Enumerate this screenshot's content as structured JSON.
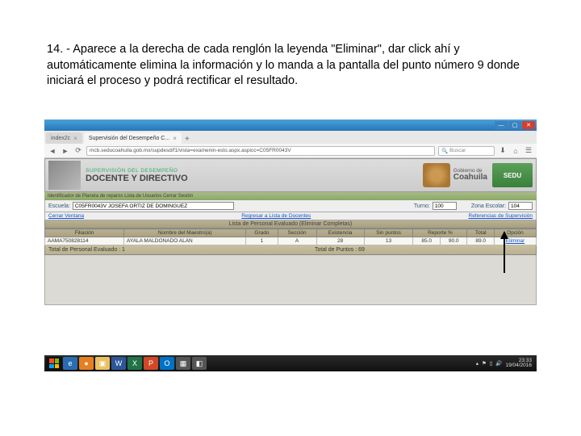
{
  "instruction": "14. - Aparece a la derecha de cada renglón la leyenda \"Eliminar\", dar click ahí  y automáticamente elimina la información y lo manda a la pantalla del punto número 9 donde iniciará el proceso y podrá rectificar el resultado.",
  "browser": {
    "tab1": "index2c",
    "tab2": "Supervisión del Desempeño C...",
    "url": "mcb.seducoahuila.gob.mx/supdesd/f1/vista=examenin-esto.aspx.aspicc=C05FR0043V",
    "search_placeholder": "Buscar"
  },
  "banner": {
    "line1": "SUPERVISIÓN DEL DESEMPEÑO",
    "line2": "DOCENTE Y DIRECTIVO",
    "gov_small": "Gobierno de",
    "gov_big": "Coahuila",
    "sedu": "SEDU",
    "sub": "Identificador de Planeta de reparos  Lista de Usuarios  Cerrar Sesión"
  },
  "form": {
    "escuela_lbl": "Escuela:",
    "escuela_val": "C05FR0043V JOSEFA ORTIZ DE DOMINGUEZ",
    "turno_lbl": "Turno:",
    "turno_val": "100",
    "zona_lbl": "Zona Escolar:",
    "zona_val": "104"
  },
  "links": {
    "left": "Cerrar Ventana",
    "mid": "Regresar a Lista de Docentes",
    "right": "Referencias de Supervisión"
  },
  "section_title": "Lista de Personal Evaluado (Eliminar Completas)",
  "headers": {
    "filiacion": "Filiación",
    "nombre": "Nombre del Maestro(a)",
    "grado": "Grado",
    "seccion": "Sección",
    "existencia": "Existencia",
    "sinpuntos": "Sin puntos",
    "reporte": "Reporte %",
    "total": "Total",
    "opcion": "Opción"
  },
  "row": {
    "filiacion": "AAMA750828114",
    "nombre": "AYALA MALDONADO ALAN",
    "grado": "1",
    "seccion": "A",
    "existencia": "28",
    "sinpuntos": "13",
    "col7": "85.0",
    "col8": "90.0",
    "total": "89.0",
    "opcion": "Eliminar"
  },
  "totals": {
    "left": "Total de Personal Evaluado : 1",
    "right": "Total de Puntos : 69"
  },
  "tray": {
    "time": "23:33",
    "date": "19/04/2016"
  }
}
